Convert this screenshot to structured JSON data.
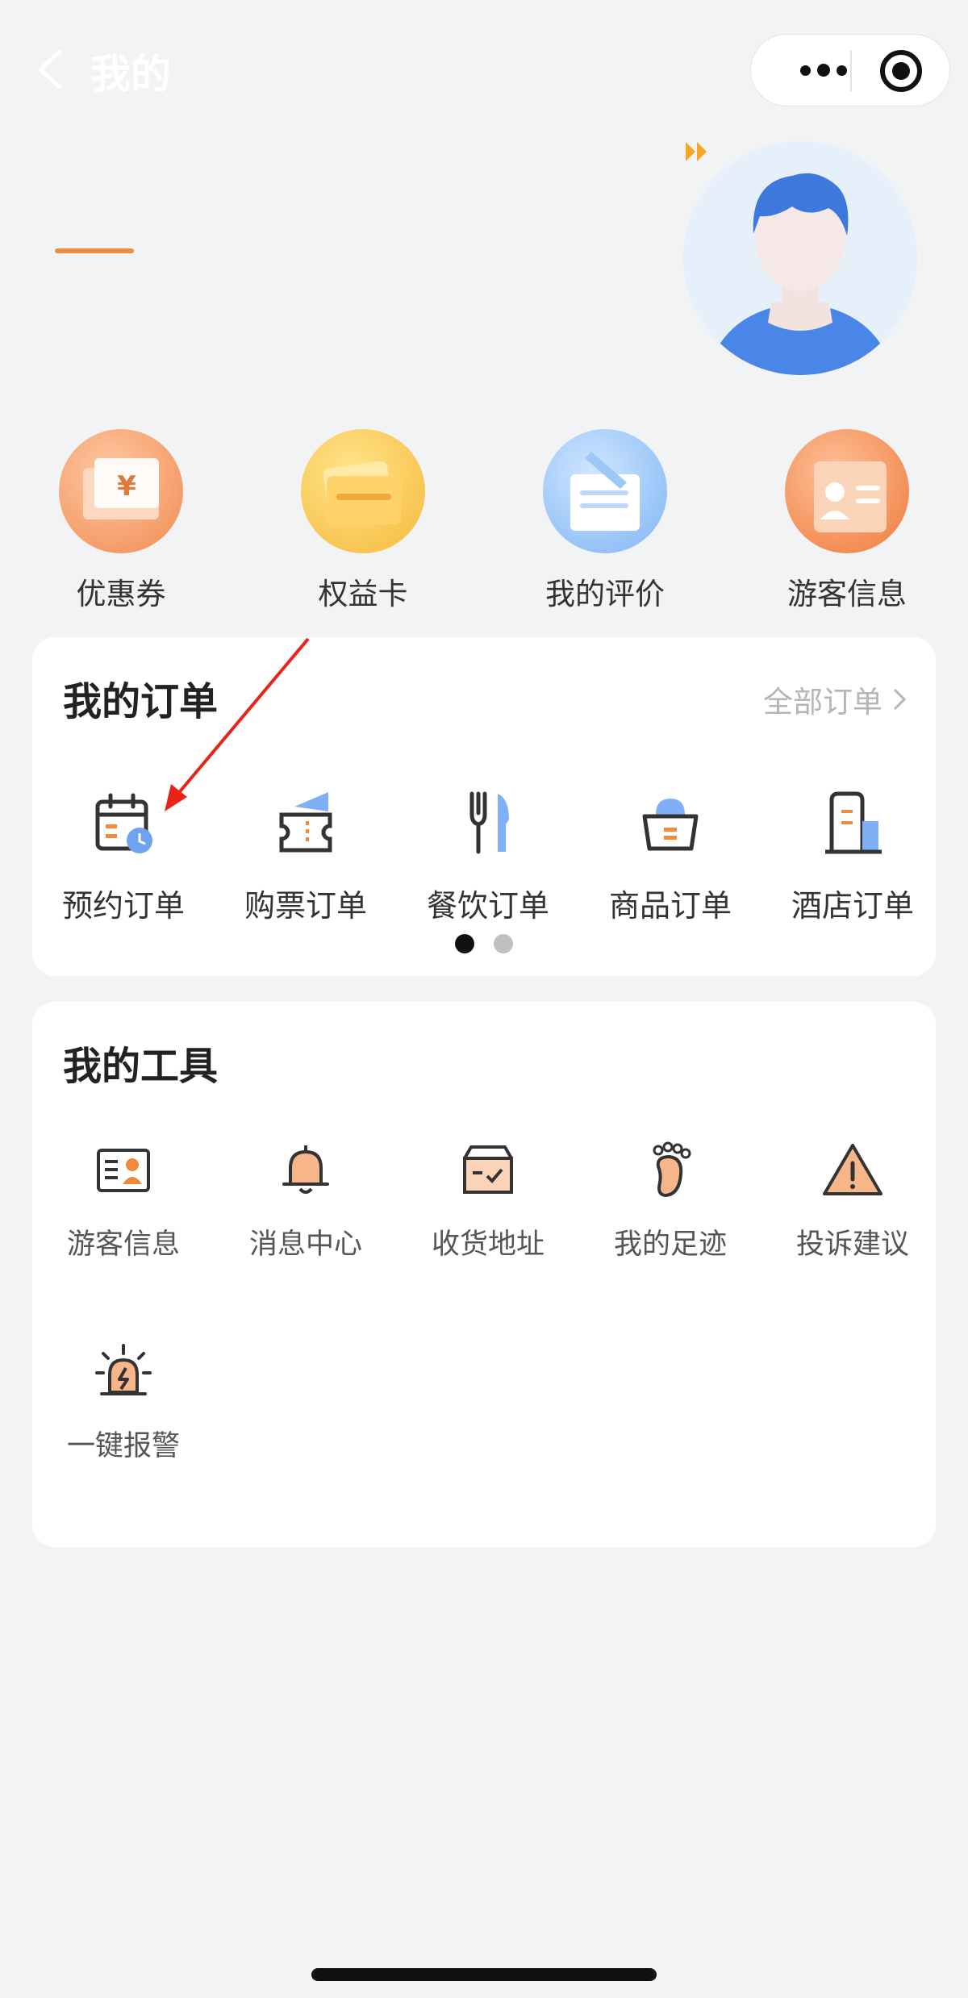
{
  "nav": {
    "title": "我的"
  },
  "quick": [
    {
      "label": "优惠券",
      "icon": "coupon-icon"
    },
    {
      "label": "权益卡",
      "icon": "card-icon"
    },
    {
      "label": "我的评价",
      "icon": "review-icon"
    },
    {
      "label": "游客信息",
      "icon": "visitor-info-icon"
    }
  ],
  "orders": {
    "title": "我的订单",
    "all_label": "全部订单",
    "items": [
      {
        "label": "预约订单",
        "icon": "calendar-clock-icon"
      },
      {
        "label": "购票订单",
        "icon": "ticket-icon"
      },
      {
        "label": "餐饮订单",
        "icon": "fork-knife-icon"
      },
      {
        "label": "商品订单",
        "icon": "shopping-bag-icon"
      },
      {
        "label": "酒店订单",
        "icon": "hotel-icon"
      }
    ],
    "pager": {
      "pages": 2,
      "current": 1
    }
  },
  "tools": {
    "title": "我的工具",
    "items": [
      {
        "label": "游客信息",
        "icon": "id-card-icon"
      },
      {
        "label": "消息中心",
        "icon": "bell-icon"
      },
      {
        "label": "收货地址",
        "icon": "delivery-box-icon"
      },
      {
        "label": "我的足迹",
        "icon": "footprint-icon"
      },
      {
        "label": "投诉建议",
        "icon": "warning-icon"
      },
      {
        "label": "一键报警",
        "icon": "alarm-icon"
      }
    ]
  },
  "colors": {
    "accent": "#f08a3c",
    "background": "#f2f3f5",
    "blue": "#4a86e8",
    "pager_active": "#111111",
    "pager_inactive": "#c0c0c0"
  }
}
